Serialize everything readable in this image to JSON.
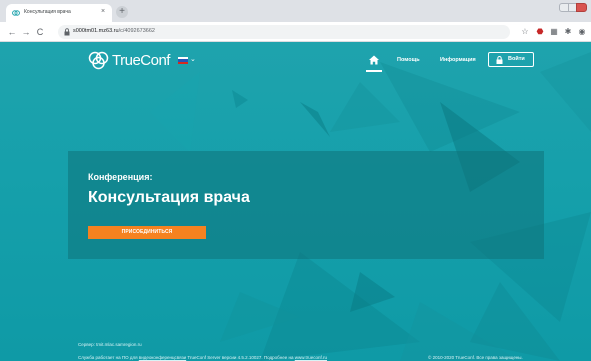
{
  "browser": {
    "tab_title": "Консультация врача",
    "new_tab_symbol": "+",
    "close_symbol": "×",
    "url_host": "s000tm01.mz63.ru",
    "url_path": "/c/4092673662",
    "back_symbol": "←",
    "forward_symbol": "→",
    "reload_symbol": "C"
  },
  "site": {
    "logo_text": "TrueConf",
    "nav": {
      "help": "Помощь",
      "info": "Информация",
      "login": "Войти"
    }
  },
  "conference": {
    "label": "Конференция:",
    "title": "Консультация врача",
    "join_button": "ПРИСОЕДИНИТЬСЯ"
  },
  "footer": {
    "server": "Сервер: tmit.mlac.samregion.ru",
    "service_prefix": "Служба работает на ПО для ",
    "service_link": "видеоконференцсвязи",
    "service_middle": " TrueConf Server версии 4.5.2.10027. Подробнее на ",
    "service_site": "www.trueconf.ru",
    "copyright": "© 2010-2020 TrueConf. Все права защищены."
  },
  "colors": {
    "background": "#16a0ab",
    "panel": "#0e727a",
    "accent_button": "#f58220"
  }
}
